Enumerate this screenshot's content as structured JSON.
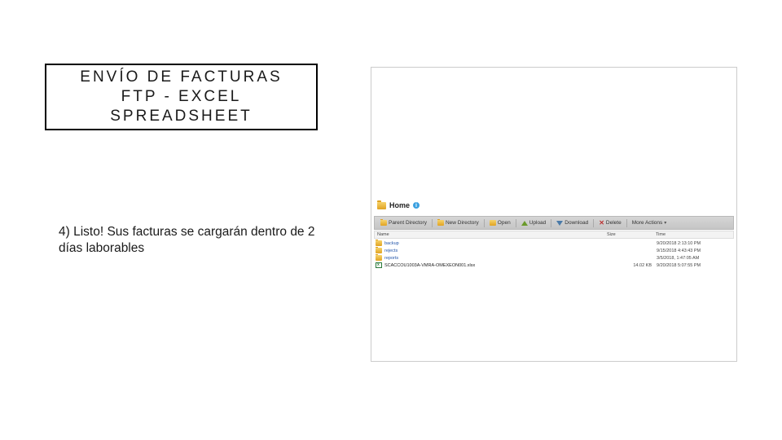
{
  "title": "ENVÍO DE FACTURAS FTP - EXCEL SPREADSHEET",
  "body": "4) Listo! Sus facturas se cargarán dentro de 2 días laborables",
  "ftp": {
    "home_label": "Home",
    "toolbar": {
      "parent": "Parent Directory",
      "newdir": "New Directory",
      "open": "Open",
      "upload": "Upload",
      "download": "Download",
      "delete": "Delete",
      "more": "More Actions"
    },
    "headers": {
      "name": "Name",
      "size": "Size",
      "time": "Time"
    },
    "rows": [
      {
        "type": "folder",
        "name": "backup",
        "size": "",
        "time": "9/20/2018  2:13:10 PM"
      },
      {
        "type": "folder",
        "name": "rejects",
        "size": "",
        "time": "9/15/2018  4:43:43 PM"
      },
      {
        "type": "folder",
        "name": "reports",
        "size": "",
        "time": "3/5/2018,  1:47:05 AM"
      },
      {
        "type": "excel",
        "name": "SCACCOU1003A-VMRA-OMEXEON001.xlsx",
        "size": "14.02 KB",
        "time": "9/20/2018  5:07:55 PM"
      }
    ]
  }
}
